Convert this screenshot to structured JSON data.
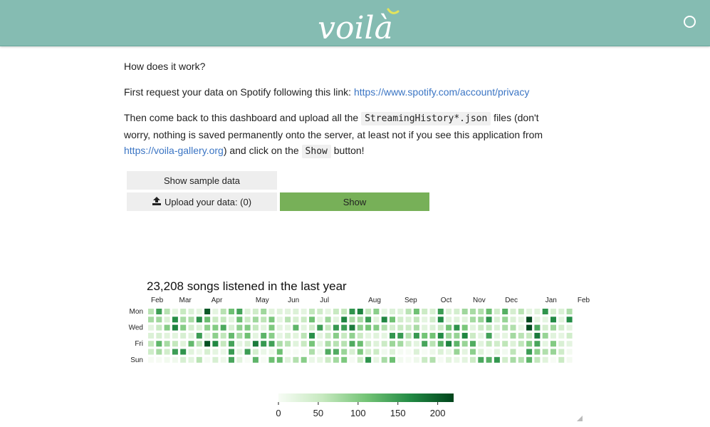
{
  "header": {
    "brand": "voilà",
    "background": "#85bcb2"
  },
  "intro": {
    "question": "How does it work?",
    "step1_text": "First request your data on Spotify following this link: ",
    "step1_link": "https://www.spotify.com/account/privacy",
    "step2_a": "Then come back to this dashboard and upload all the ",
    "step2_code": "StreamingHistory*.json",
    "step2_b": " files (don't worry, nothing is saved permanently onto the server, at least not if you see this application from ",
    "step2_link": "https://voila-gallery.org",
    "step2_c": ") and click on the ",
    "step2_code2": "Show",
    "step2_d": " button!"
  },
  "controls": {
    "sample_label": "Show sample data",
    "upload_label": "Upload your data: (0)",
    "upload_icon": "upload-icon",
    "show_label": "Show",
    "show_color": "#77b058"
  },
  "chart_data": {
    "type": "heatmap",
    "title": "23,208 songs listened in the last year",
    "months": [
      "Feb",
      "Mar",
      "Apr",
      "May",
      "Jun",
      "Jul",
      "Aug",
      "Sep",
      "Oct",
      "Nov",
      "Dec",
      "Jan",
      "Feb"
    ],
    "day_labels": [
      "Mon",
      "",
      "Wed",
      "",
      "Fri",
      "",
      "Sun"
    ],
    "weeks": 53,
    "colorbar_ticks": [
      0,
      50,
      100,
      150,
      200
    ],
    "colorbar_range": [
      0,
      220
    ],
    "colormap": [
      "#f7fcf5",
      "#c7e9c0",
      "#74c476",
      "#238b45",
      "#00441b"
    ]
  }
}
